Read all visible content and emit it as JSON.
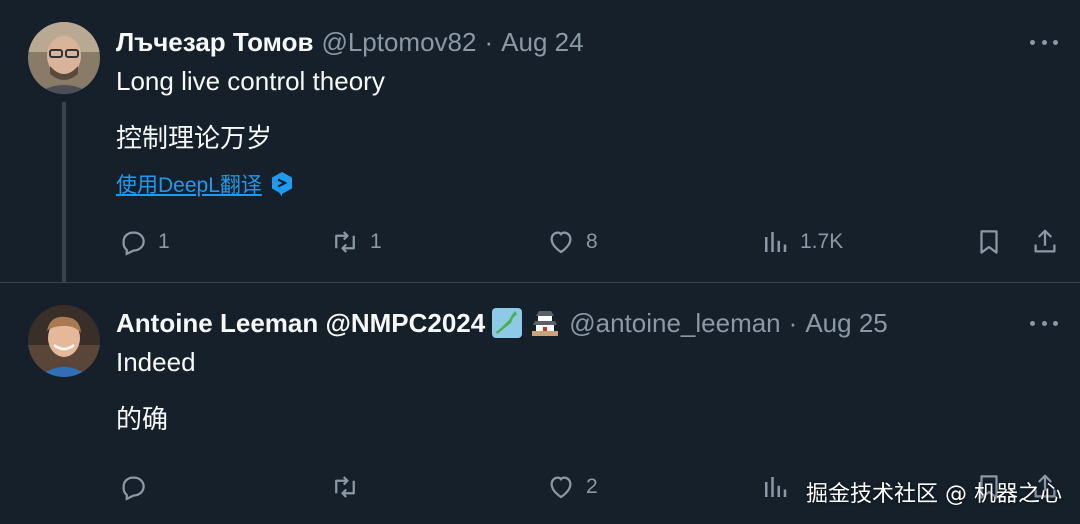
{
  "tweets": [
    {
      "author_name": "Лъчезар Томов",
      "handle": "@Lptomov82",
      "separator": "·",
      "date": "Aug 24",
      "text_lines": [
        "Long live control theory",
        "控制理论万岁"
      ],
      "translate_label": "使用DeepL翻译",
      "counts": {
        "reply": "1",
        "retweet": "1",
        "like": "8",
        "views": "1.7K"
      }
    },
    {
      "author_name": "Antoine Leeman @NMPC2024",
      "handle": "@antoine_leeman",
      "separator": "·",
      "date": "Aug 25",
      "text_lines": [
        "Indeed",
        "的确"
      ],
      "counts": {
        "reply": "",
        "retweet": "",
        "like": "2",
        "views": ""
      }
    }
  ],
  "watermark": "掘金技术社区 @ 机器之心",
  "colors": {
    "background": "#15202b",
    "muted": "#8b98a5",
    "link": "#1d9bf0",
    "divider": "#38444d"
  }
}
